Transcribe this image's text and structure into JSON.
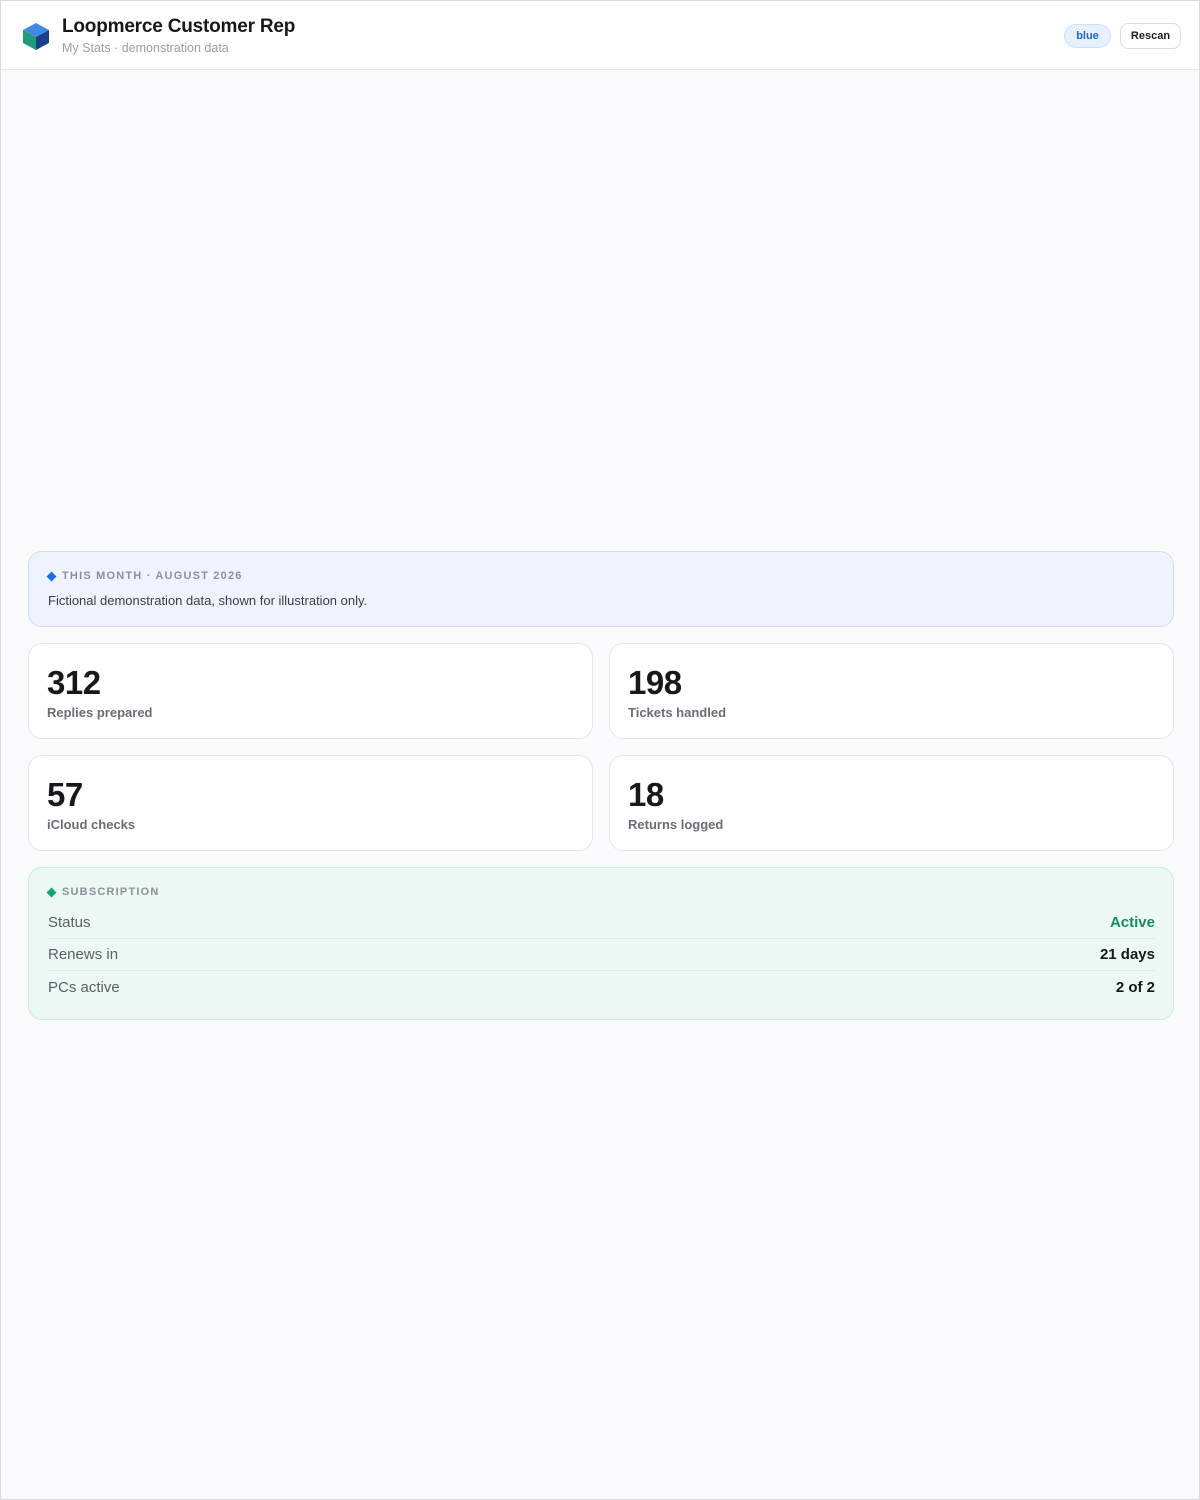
{
  "header": {
    "title": "Loopmerce Customer Rep",
    "subtitle": "My Stats · demonstration data",
    "theme_label": "blue",
    "rescan_label": "Rescan",
    "logo_icon": "cube-logo-icon"
  },
  "this_month": {
    "heading": "THIS MONTH · AUGUST 2026",
    "note": "Fictional demonstration data, shown for illustration only.",
    "accent": "#1e6fdc"
  },
  "stats": [
    {
      "value": "312",
      "label": "Replies prepared"
    },
    {
      "value": "198",
      "label": "Tickets handled"
    },
    {
      "value": "57",
      "label": "iCloud checks"
    },
    {
      "value": "18",
      "label": "Returns logged"
    }
  ],
  "subscription": {
    "heading": "SUBSCRIPTION",
    "accent": "#14a37a",
    "rows": [
      {
        "key": "Status",
        "value": "Active",
        "value_color": "#178a62"
      },
      {
        "key": "Renews in",
        "value": "21 days"
      },
      {
        "key": "PCs active",
        "value": "2 of 2"
      }
    ]
  }
}
